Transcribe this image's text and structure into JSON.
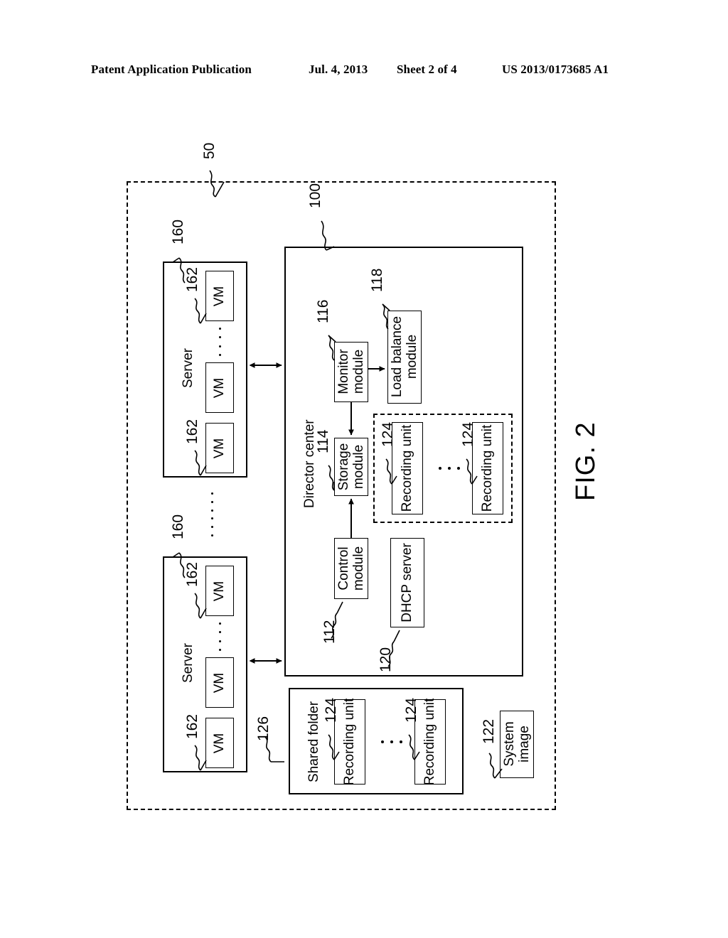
{
  "header": {
    "publication": "Patent Application Publication",
    "date": "Jul. 4, 2013",
    "sheet": "Sheet 2 of 4",
    "patent_number": "US 2013/0173685 A1"
  },
  "figure": {
    "caption": "FIG. 2",
    "system_ref": "50",
    "nodes": {
      "director_center": {
        "label": "Director center",
        "ref": "100"
      },
      "monitor_module": {
        "label_line1": "Monitor",
        "label_line2": "module",
        "ref": "116"
      },
      "load_balance_module": {
        "label_line1": "Load balance",
        "label_line2": "module",
        "ref": "118"
      },
      "storage_module": {
        "label_line1": "Storage",
        "label_line2": "module",
        "ref": "114"
      },
      "control_module": {
        "label_line1": "Control",
        "label_line2": "module",
        "ref": "112"
      },
      "dhcp_server": {
        "label": "DHCP server",
        "ref": "120"
      },
      "shared_folder": {
        "label": "Shared folder",
        "ref": "126"
      },
      "system_image": {
        "label_line1": "System",
        "label_line2": "image",
        "ref": "122"
      },
      "recording_unit": {
        "label": "Recording unit",
        "ref": "124"
      },
      "server": {
        "label": "Server",
        "ref": "160"
      },
      "vm": {
        "label": "VM",
        "ref": "162"
      }
    },
    "servers": [
      {
        "label": "Server",
        "ref": "160",
        "vms": [
          {
            "label": "VM",
            "ref": "162"
          },
          {
            "label": "VM",
            "ref": ""
          },
          {
            "label": "VM",
            "ref": "162"
          }
        ]
      },
      {
        "label": "Server",
        "ref": "160",
        "vms": [
          {
            "label": "VM",
            "ref": "162"
          },
          {
            "label": "VM",
            "ref": ""
          },
          {
            "label": "VM",
            "ref": "162"
          }
        ]
      }
    ],
    "storage_recording_units": [
      {
        "label": "Recording unit",
        "ref": "124"
      },
      {
        "label": "Recording unit",
        "ref": "124"
      }
    ],
    "shared_folder_recording_units": [
      {
        "label": "Recording unit",
        "ref": "124"
      },
      {
        "label": "Recording unit",
        "ref": "124"
      }
    ]
  }
}
